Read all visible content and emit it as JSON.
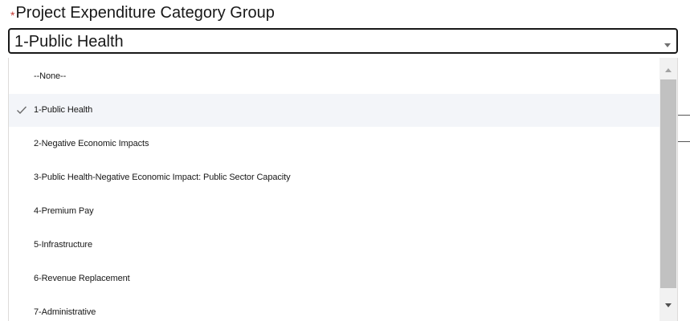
{
  "field": {
    "required_mark": "*",
    "label": "Project Expenditure Category Group"
  },
  "combobox": {
    "selected_value": "1-Public Health",
    "arrow_icon": "chevron-down-icon"
  },
  "listbox": {
    "options": [
      {
        "label": "--None--",
        "selected": false
      },
      {
        "label": "1-Public Health",
        "selected": true
      },
      {
        "label": "2-Negative Economic Impacts",
        "selected": false
      },
      {
        "label": "3-Public Health-Negative Economic Impact: Public Sector Capacity",
        "selected": false
      },
      {
        "label": "4-Premium Pay",
        "selected": false
      },
      {
        "label": "5-Infrastructure",
        "selected": false
      },
      {
        "label": "6-Revenue Replacement",
        "selected": false
      },
      {
        "label": "7-Administrative",
        "selected": false
      }
    ],
    "check_icon": "checkmark-icon"
  },
  "colors": {
    "selected_bg": "#f3f5f9",
    "required": "#c23934",
    "text": "#181818",
    "scrollbar_track": "#f1f1f1",
    "scrollbar_thumb": "#c1c1c1"
  }
}
